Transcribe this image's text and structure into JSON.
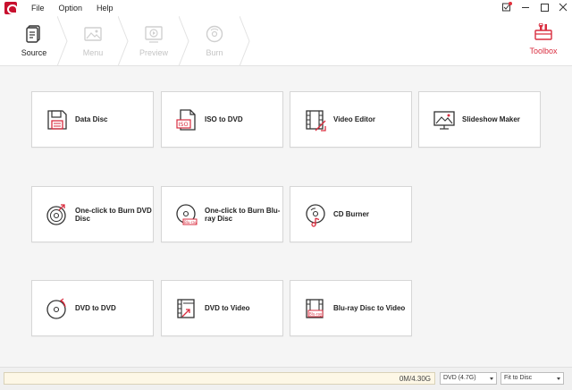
{
  "menu": {
    "items": [
      "File",
      "Option",
      "Help"
    ]
  },
  "steps": [
    {
      "label": "Source",
      "icon": "source-doc-icon",
      "active": true
    },
    {
      "label": "Menu",
      "icon": "menu-image-icon",
      "active": false
    },
    {
      "label": "Preview",
      "icon": "preview-play-icon",
      "active": false
    },
    {
      "label": "Burn",
      "icon": "burn-disc-icon",
      "active": false
    }
  ],
  "toolbox": {
    "label": "Toolbox",
    "icon": "toolbox-icon"
  },
  "tiles": [
    {
      "label": "Data Disc",
      "icon": "floppy-disk-icon"
    },
    {
      "label": "ISO to DVD",
      "icon": "iso-file-icon"
    },
    {
      "label": "Video Editor",
      "icon": "film-edit-icon"
    },
    {
      "label": "Slideshow Maker",
      "icon": "slideshow-monitor-icon"
    },
    {
      "label": "One-click to Burn DVD Disc",
      "icon": "dvd-burn-icon"
    },
    {
      "label": "One-click to Burn Blu-ray Disc",
      "icon": "bluray-burn-icon"
    },
    {
      "label": "CD Burner",
      "icon": "cd-music-icon"
    },
    {
      "label": "DVD to DVD",
      "icon": "dvd-copy-icon"
    },
    {
      "label": "DVD to Video",
      "icon": "dvd-to-video-icon"
    },
    {
      "label": "Blu-ray Disc to Video",
      "icon": "bluray-to-video-icon"
    }
  ],
  "status": {
    "capacity": "0M/4.30G",
    "disc_type": "DVD (4.7G)",
    "fit_mode": "Fit to Disc"
  },
  "colors": {
    "accent": "#d92d3f"
  }
}
